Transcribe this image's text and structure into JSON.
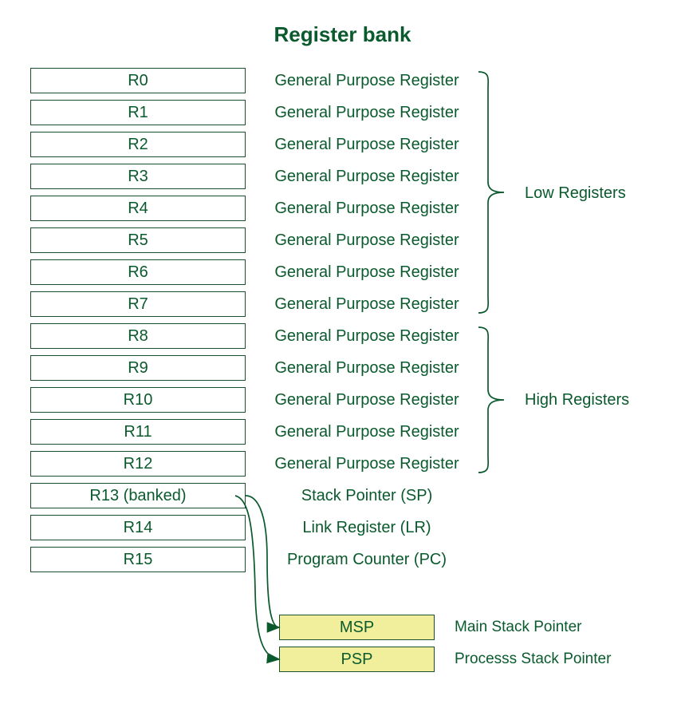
{
  "title": "Register bank",
  "registers": [
    {
      "name": "R0",
      "desc": "General Purpose Register"
    },
    {
      "name": "R1",
      "desc": "General Purpose Register"
    },
    {
      "name": "R2",
      "desc": "General Purpose Register"
    },
    {
      "name": "R3",
      "desc": "General Purpose Register"
    },
    {
      "name": "R4",
      "desc": "General Purpose Register"
    },
    {
      "name": "R5",
      "desc": "General Purpose Register"
    },
    {
      "name": "R6",
      "desc": "General Purpose Register"
    },
    {
      "name": "R7",
      "desc": "General Purpose Register"
    },
    {
      "name": "R8",
      "desc": "General Purpose Register"
    },
    {
      "name": "R9",
      "desc": "General Purpose Register"
    },
    {
      "name": "R10",
      "desc": "General Purpose Register"
    },
    {
      "name": "R11",
      "desc": "General Purpose Register"
    },
    {
      "name": "R12",
      "desc": "General Purpose Register"
    },
    {
      "name": "R13 (banked)",
      "desc": "Stack Pointer (SP)"
    },
    {
      "name": "R14",
      "desc": "Link Register (LR)"
    },
    {
      "name": "R15",
      "desc": "Program Counter (PC)"
    }
  ],
  "groups": {
    "low": "Low Registers",
    "high": "High Registers"
  },
  "stack_pointers": [
    {
      "name": "MSP",
      "desc": "Main Stack Pointer"
    },
    {
      "name": "PSP",
      "desc": "Processs Stack Pointer"
    }
  ],
  "colors": {
    "text": "#0a5a2d",
    "border": "#1a4f2d",
    "sp_fill": "#f2ef9c"
  }
}
